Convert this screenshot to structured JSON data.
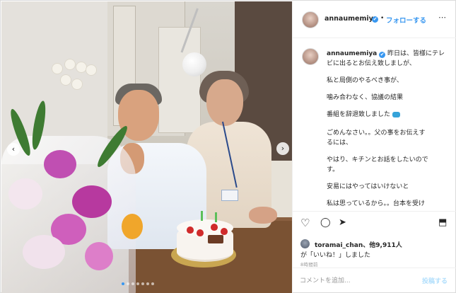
{
  "post": {
    "username": "annaumemiya",
    "verified_mark": "✔",
    "follow_label": "フォローする",
    "separator": "•",
    "more_label": "⋯",
    "caption_lines": [
      "昨日は、皆様にテレ",
      "ビに出るとお伝え致しましが、",
      "私と局側のやるべき事が、",
      "噛み合わなく、協議の結果",
      "番組を辞退致しました",
      "ごめんなさい。。父の事をお伝えす",
      "るには、",
      "やはり、キチンとお話をしたいので",
      "す。",
      "安易にはやってはいけないと",
      "私は思っているから。。台本を受け"
    ],
    "liker_name": "toramai_chan",
    "likes_suffix": "、他9,911人",
    "likes_line2": "が「いいね！」しました",
    "timestamp": "8時間前",
    "comment_placeholder": "コメントを追加...",
    "post_button": "投稿する",
    "carousel_next": "›",
    "carousel_prev": "‹"
  },
  "icons": {
    "heart": "♡",
    "comment": "◯",
    "share": "➤",
    "save": "⬒"
  },
  "colors": {
    "accent": "#3897f0",
    "post_disabled": "#b2dffc"
  }
}
